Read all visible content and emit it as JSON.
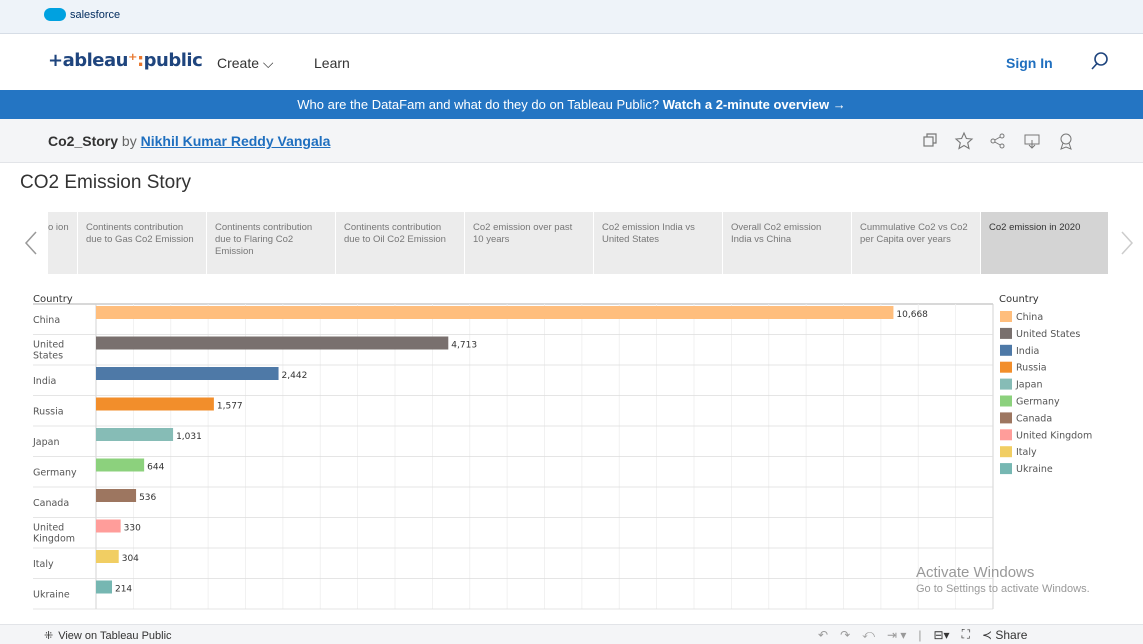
{
  "salesforce": {
    "label": "salesforce"
  },
  "nav": {
    "logo_a": "+ableau",
    "logo_b": "public",
    "create": "Create ⌵",
    "learn": "Learn",
    "sign_in": "Sign In"
  },
  "banner": {
    "text": "Who are the DataFam and what do they do on Tableau Public?",
    "link": "Watch a 2-minute overview →"
  },
  "viz": {
    "name": "Co2_Story",
    "by": "by",
    "author": "Nikhil Kumar Reddy Vangala"
  },
  "story_title": "CO2 Emission Story",
  "story_points": [
    {
      "label": "o ion"
    },
    {
      "label": "Continents contribution due to Gas Co2 Emission"
    },
    {
      "label": "Continents contribution due to Flaring Co2 Emission"
    },
    {
      "label": "Continents contribution due to Oil Co2 Emission"
    },
    {
      "label": "Co2 emission over past 10 years"
    },
    {
      "label": "Co2 emission India vs United States"
    },
    {
      "label": "Overall Co2 emission India vs China"
    },
    {
      "label": "Cummulative Co2 vs Co2 per Capita over years"
    },
    {
      "label": "Co2 emission in 2020"
    }
  ],
  "chart_data": {
    "type": "bar",
    "orientation": "horizontal",
    "row_header": "Country",
    "categories": [
      "China",
      "United States",
      "India",
      "Russia",
      "Japan",
      "Germany",
      "Canada",
      "United Kingdom",
      "Italy",
      "Ukraine"
    ],
    "values": [
      10668,
      4713,
      2442,
      1577,
      1031,
      644,
      536,
      330,
      304,
      214
    ],
    "value_labels": [
      "10,668",
      "4,713",
      "2,442",
      "1,577",
      "1,031",
      "644",
      "536",
      "330",
      "304",
      "214"
    ],
    "colors": [
      "#ffbe7d",
      "#79706e",
      "#4e79a7",
      "#f28e2b",
      "#86bcb6",
      "#8cd17d",
      "#9d7660",
      "#ff9d9a",
      "#f1ce63",
      "#76b7b2"
    ],
    "legend_title": "Country",
    "legend_placement": "right",
    "grid": true
  },
  "watermark": {
    "line1": "Activate Windows",
    "line2": "Go to Settings to activate Windows."
  },
  "footer": {
    "view_on": "View on Tableau Public",
    "share": "Share"
  }
}
